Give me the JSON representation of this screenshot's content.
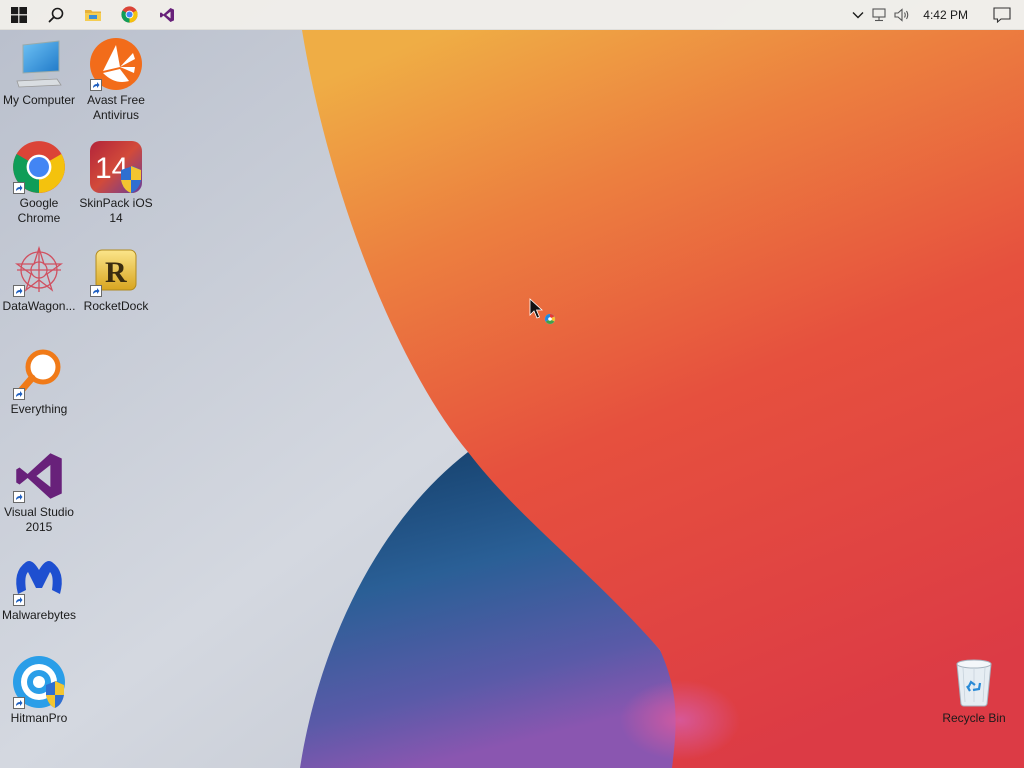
{
  "taskbar": {
    "pinned": [
      {
        "name": "start-button",
        "icon": "windows-logo-icon"
      },
      {
        "name": "search-button",
        "icon": "search-icon"
      },
      {
        "name": "file-explorer-button",
        "icon": "folder-icon"
      },
      {
        "name": "chrome-taskbar-button",
        "icon": "chrome-icon"
      },
      {
        "name": "visual-studio-taskbar-button",
        "icon": "visual-studio-icon"
      }
    ],
    "tray": {
      "time": "4:42 PM",
      "icons": [
        "chevron-up-icon",
        "network-icon",
        "volume-icon",
        "notification-icon"
      ]
    }
  },
  "desktop": {
    "icons": [
      {
        "label": "My Computer",
        "icon": "computer-icon",
        "shortcut": false
      },
      {
        "label": "Avast Free Antivirus",
        "icon": "avast-icon",
        "shortcut": true
      },
      {
        "label": "Google Chrome",
        "icon": "chrome-icon",
        "shortcut": true
      },
      {
        "label": "SkinPack iOS 14",
        "icon": "skinpack-icon",
        "shortcut": false
      },
      {
        "label": "DataWagon...",
        "icon": "datawagon-icon",
        "shortcut": true
      },
      {
        "label": "RocketDock",
        "icon": "rocketdock-icon",
        "shortcut": true
      },
      {
        "label": "Everything",
        "icon": "magnifier-icon",
        "shortcut": true
      },
      {
        "label": "Visual Studio 2015",
        "icon": "visual-studio-icon",
        "shortcut": true
      },
      {
        "label": "Malwarebytes",
        "icon": "malwarebytes-icon",
        "shortcut": true
      },
      {
        "label": "HitmanPro",
        "icon": "hitmanpro-icon",
        "shortcut": true
      },
      {
        "label": "Recycle Bin",
        "icon": "recycle-bin-icon",
        "shortcut": false
      }
    ]
  },
  "colors": {
    "wallpaper_bg": "#c5cad4",
    "wallpaper_orange": "#e8563a",
    "wallpaper_yellow": "#efae42",
    "wallpaper_blue": "#1f4e80",
    "wallpaper_purple": "#7a4fa6"
  }
}
